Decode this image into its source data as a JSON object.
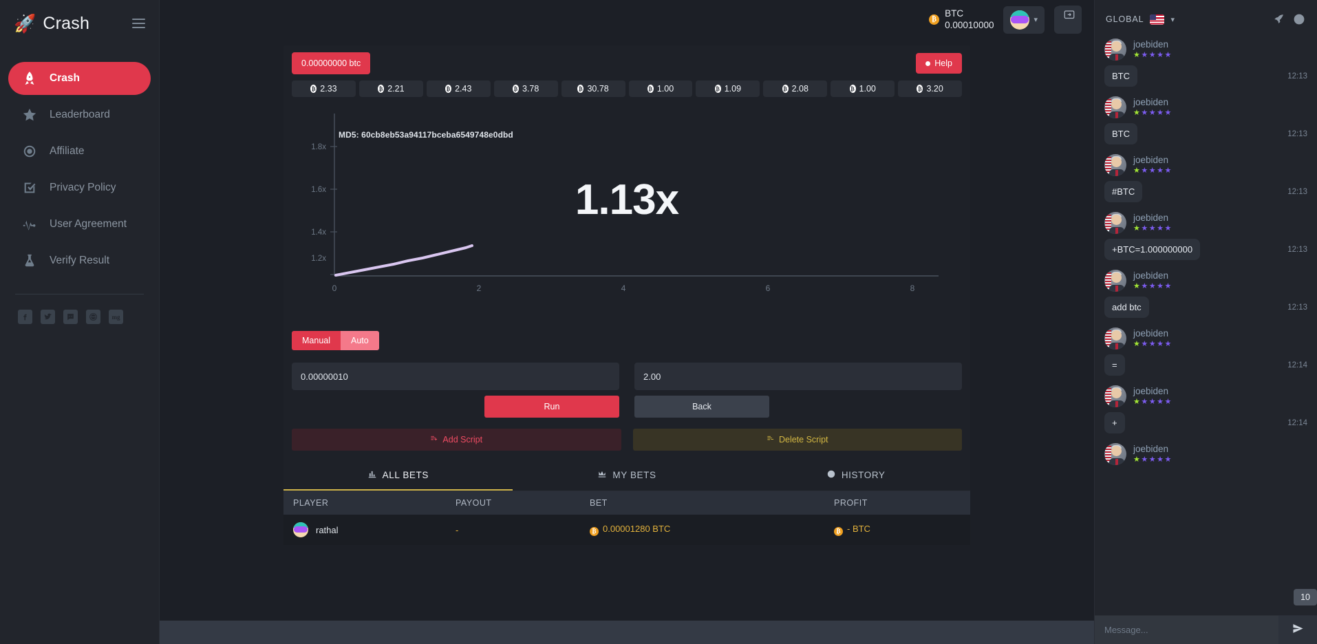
{
  "brand": {
    "name": "Crash",
    "rocket_icon": "rocket-icon",
    "menu_icon": "hamburger-icon"
  },
  "sidebar": {
    "items": [
      {
        "label": "Crash",
        "icon": "rocket-icon",
        "active": true
      },
      {
        "label": "Leaderboard",
        "icon": "star-icon",
        "active": false
      },
      {
        "label": "Affiliate",
        "icon": "target-icon",
        "active": false
      },
      {
        "label": "Privacy Policy",
        "icon": "checkbox-icon",
        "active": false
      },
      {
        "label": "User Agreement",
        "icon": "pulse-icon",
        "active": false
      },
      {
        "label": "Verify Result",
        "icon": "flask-icon",
        "active": false
      }
    ],
    "socials": [
      {
        "name": "facebook-icon",
        "label": "f"
      },
      {
        "name": "twitter-icon",
        "label": "t"
      },
      {
        "name": "discord-icon",
        "label": "d"
      },
      {
        "name": "dribbble-icon",
        "label": "b"
      },
      {
        "name": "mg-icon",
        "label": "mg"
      }
    ]
  },
  "header": {
    "currency": "BTC",
    "balance": "0.00010000",
    "avatar_icon": "user-avatar",
    "chevron_icon": "chevron-down-icon",
    "bell_icon": "bell-icon",
    "chat_toggle_icon": "chat-toggle-icon"
  },
  "game": {
    "bet_pill": "0.00000000 btc",
    "help_label": "Help",
    "history_multipliers": [
      "2.33",
      "2.21",
      "2.43",
      "3.78",
      "30.78",
      "1.00",
      "1.09",
      "2.08",
      "1.00",
      "3.20"
    ],
    "md5_label": "MD5: 60cb8eb53a94117bceba6549748e0dbd",
    "current_multiplier": "1.13x",
    "mode_tabs": [
      {
        "label": "Manual",
        "active": false
      },
      {
        "label": "Auto",
        "active": true
      }
    ],
    "bet_amount": "0.00000010",
    "auto_cashout": "2.00",
    "run_label": "Run",
    "back_label": "Back",
    "add_script_label": "Add Script",
    "delete_script_label": "Delete Script"
  },
  "chart_data": {
    "type": "line",
    "title": "",
    "xlabel": "",
    "ylabel": "",
    "x_ticks": [
      0,
      2,
      4,
      6,
      8
    ],
    "y_ticks": [
      "1.2x",
      "1.4x",
      "1.6x",
      "1.8x"
    ],
    "y_tick_values": [
      1.2,
      1.4,
      1.6,
      1.8
    ],
    "xlim": [
      0,
      9.2
    ],
    "ylim": [
      1.0,
      1.92
    ],
    "grid": false,
    "legend": null,
    "series": [
      {
        "name": "multiplier",
        "color": "#d9c6f0",
        "x": [
          0,
          0.2,
          0.4,
          0.6,
          0.8,
          1.0,
          1.2,
          1.4,
          1.6,
          1.8,
          1.9
        ],
        "y": [
          1.0,
          1.012,
          1.026,
          1.04,
          1.055,
          1.07,
          1.085,
          1.1,
          1.112,
          1.125,
          1.13
        ]
      }
    ],
    "annotations": [
      {
        "text": "MD5: 60cb8eb53a94117bceba6549748e0dbd",
        "x": 0.3,
        "y": 1.86
      },
      {
        "text": "1.13x",
        "x": 4.3,
        "y": 1.52
      }
    ]
  },
  "bets": {
    "tabs": [
      {
        "label": "ALL BETS",
        "icon": "bar-chart-icon",
        "active": true
      },
      {
        "label": "MY BETS",
        "icon": "chart-icon",
        "active": false
      },
      {
        "label": "HISTORY",
        "icon": "clock-icon",
        "active": false
      }
    ],
    "columns": [
      "PLAYER",
      "PAYOUT",
      "BET",
      "PROFIT"
    ],
    "rows": [
      {
        "player": "rathal",
        "payout": "-",
        "bet": "0.00001280 BTC",
        "profit": "- BTC"
      }
    ]
  },
  "chat": {
    "channel": "GLOBAL",
    "flag_icon": "us-flag-icon",
    "chevron_icon": "chevron-down-icon",
    "rocket_icon": "rocket-icon",
    "info_icon": "info-icon",
    "unread_count": "10",
    "input_placeholder": "Message...",
    "send_icon": "send-icon",
    "messages": [
      {
        "user": "joebiden",
        "stars": 5,
        "text": "BTC",
        "time": "12:13"
      },
      {
        "user": "joebiden",
        "stars": 5,
        "text": "BTC",
        "time": "12:13"
      },
      {
        "user": "joebiden",
        "stars": 5,
        "text": "#BTC",
        "time": "12:13"
      },
      {
        "user": "joebiden",
        "stars": 5,
        "text": "+BTC=1.000000000",
        "time": "12:13"
      },
      {
        "user": "joebiden",
        "stars": 5,
        "text": "add btc",
        "time": "12:13"
      },
      {
        "user": "joebiden",
        "stars": 5,
        "text": "=",
        "time": "12:14"
      },
      {
        "user": "joebiden",
        "stars": 5,
        "text": "+",
        "time": "12:14"
      },
      {
        "user": "joebiden",
        "stars": 5,
        "text": "",
        "time": ""
      }
    ]
  },
  "colors": {
    "accent_red": "#e0384c",
    "accent_gold": "#cdb34a",
    "bg_dark": "#1c1f26",
    "panel": "#1e2128",
    "curve": "#d9c6f0"
  }
}
